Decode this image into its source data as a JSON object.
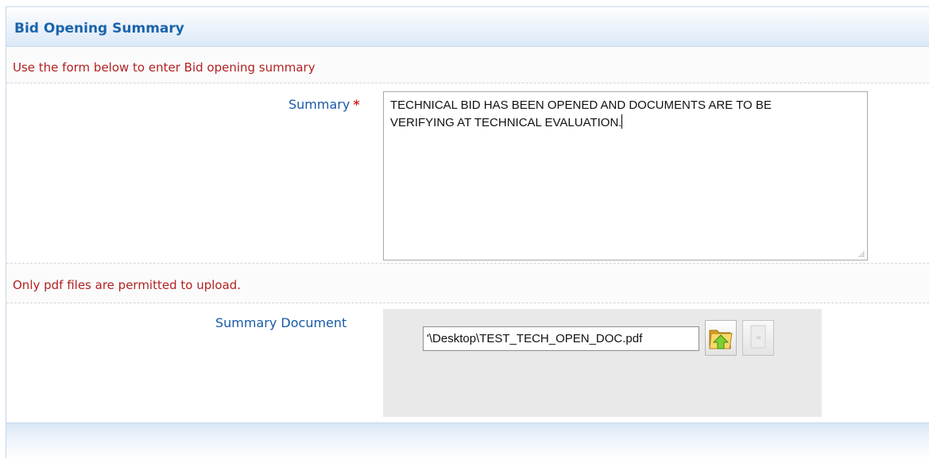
{
  "panel": {
    "title": "Bid Opening Summary"
  },
  "instructions": {
    "form_note": "Use the form below to enter Bid opening summary",
    "upload_note": "Only pdf files are permitted to upload."
  },
  "summary": {
    "label": "Summary",
    "required_mark": "*",
    "value": "TECHNICAL BID HAS BEEN OPENED AND DOCUMENTS ARE TO BE\nVERIFYING AT TECHNICAL EVALUATION."
  },
  "summary_document": {
    "label": "Summary Document",
    "file_path": "'\\Desktop\\TEST_TECH_OPEN_DOC.pdf",
    "upload_icon": "folder-upload-icon",
    "disabled_icon": "remove-file-icon"
  }
}
